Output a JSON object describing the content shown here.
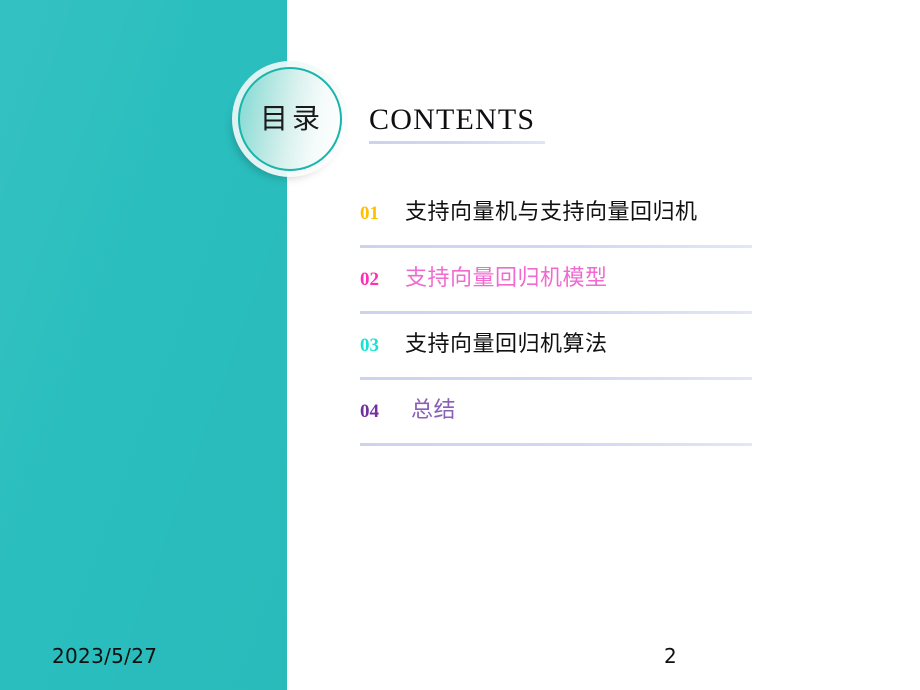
{
  "slide": {
    "background_color": "#ffffff",
    "accent_panel_color": "#2abebe"
  },
  "badge": {
    "label": "目录",
    "ring_color": "#17b5ab"
  },
  "heading": {
    "title": "CONTENTS",
    "rule_color": "#ced5f0"
  },
  "contents": {
    "separator_color": "#d2d8f1",
    "items": [
      {
        "number": "01",
        "label": "支持向量机与支持向量回归机",
        "number_color": "#ffc000",
        "label_color": "#111111"
      },
      {
        "number": "02",
        "label": "支持向量回归机模型",
        "number_color": "#ff2fb5",
        "label_color": "#f06ad0"
      },
      {
        "number": "03",
        "label": "支持向量回归机算法",
        "number_color": "#16e3d2",
        "label_color": "#111111"
      },
      {
        "number": "04",
        "label": "总结",
        "number_color": "#7030a0",
        "label_color": "#8a5fb5"
      }
    ]
  },
  "footer": {
    "date": "2023/5/27",
    "page_number": "2"
  }
}
